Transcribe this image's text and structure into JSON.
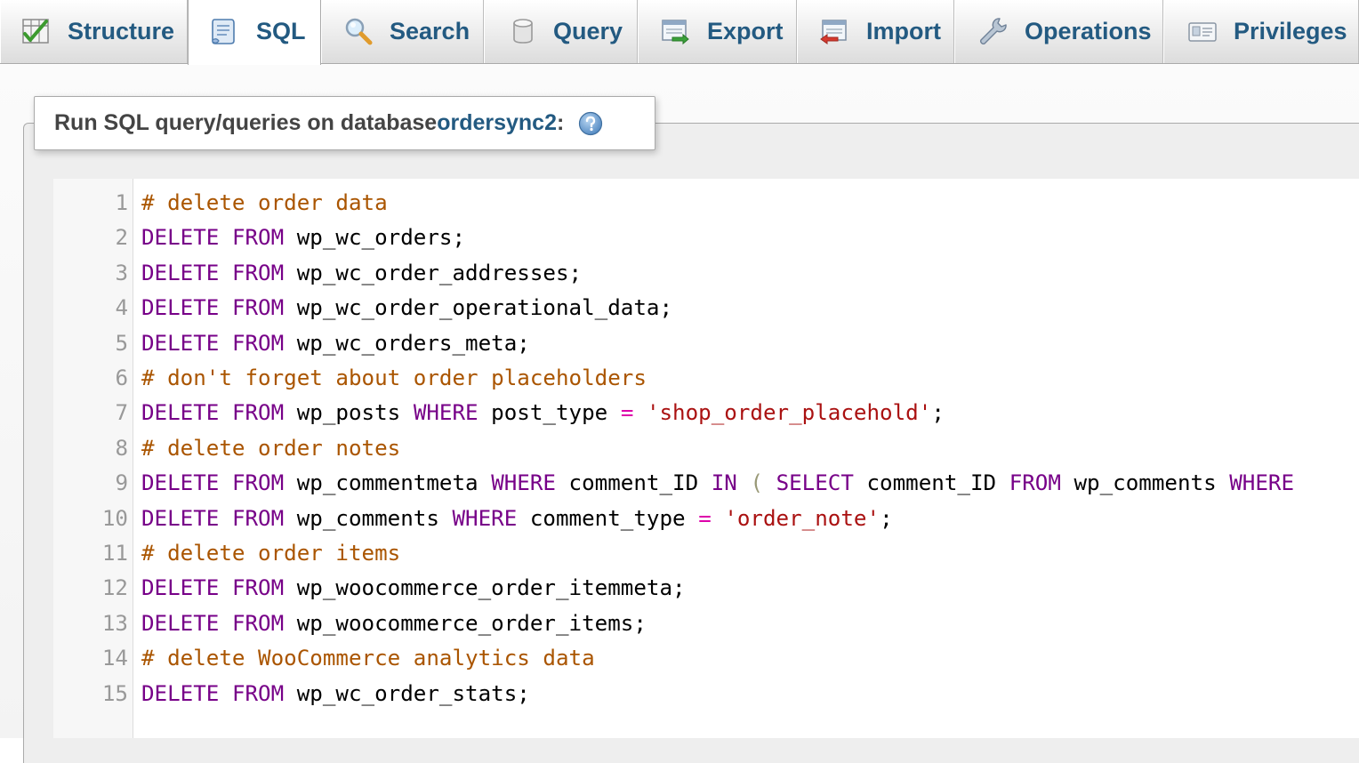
{
  "tabs": [
    {
      "id": "structure",
      "label": "Structure",
      "icon": "structure-icon",
      "active": false
    },
    {
      "id": "sql",
      "label": "SQL",
      "icon": "sql-scroll-icon",
      "active": true
    },
    {
      "id": "search",
      "label": "Search",
      "icon": "magnifier-icon",
      "active": false
    },
    {
      "id": "query",
      "label": "Query",
      "icon": "database-cylinder-icon",
      "active": false
    },
    {
      "id": "export",
      "label": "Export",
      "icon": "export-icon",
      "active": false
    },
    {
      "id": "import",
      "label": "Import",
      "icon": "import-icon",
      "active": false
    },
    {
      "id": "operations",
      "label": "Operations",
      "icon": "wrench-icon",
      "active": false
    },
    {
      "id": "privileges",
      "label": "Privileges",
      "icon": "id-card-icon",
      "active": false
    }
  ],
  "legend": {
    "prefix": "Run SQL query/queries on database ",
    "database": "ordersync2",
    "suffix": ":",
    "help_icon": "help-icon"
  },
  "colors": {
    "link": "#235a81",
    "keyword": "#770088",
    "comment": "#aa5500",
    "string": "#aa1111",
    "operator": "#dd00aa"
  },
  "editor": {
    "lines": [
      {
        "n": "1",
        "tokens": [
          [
            "cm",
            "# delete order data"
          ]
        ]
      },
      {
        "n": "2",
        "tokens": [
          [
            "kw",
            "DELETE"
          ],
          [
            "id",
            " "
          ],
          [
            "kw",
            "FROM"
          ],
          [
            "id",
            " wp_wc_orders;"
          ]
        ]
      },
      {
        "n": "3",
        "tokens": [
          [
            "kw",
            "DELETE"
          ],
          [
            "id",
            " "
          ],
          [
            "kw",
            "FROM"
          ],
          [
            "id",
            " wp_wc_order_addresses;"
          ]
        ]
      },
      {
        "n": "4",
        "tokens": [
          [
            "kw",
            "DELETE"
          ],
          [
            "id",
            " "
          ],
          [
            "kw",
            "FROM"
          ],
          [
            "id",
            " wp_wc_order_operational_data;"
          ]
        ]
      },
      {
        "n": "5",
        "tokens": [
          [
            "kw",
            "DELETE"
          ],
          [
            "id",
            " "
          ],
          [
            "kw",
            "FROM"
          ],
          [
            "id",
            " wp_wc_orders_meta;"
          ]
        ]
      },
      {
        "n": "6",
        "tokens": [
          [
            "cm",
            "# don't forget about order placeholders"
          ]
        ]
      },
      {
        "n": "7",
        "tokens": [
          [
            "kw",
            "DELETE"
          ],
          [
            "id",
            " "
          ],
          [
            "kw",
            "FROM"
          ],
          [
            "id",
            " wp_posts "
          ],
          [
            "kw",
            "WHERE"
          ],
          [
            "id",
            " post_type "
          ],
          [
            "op",
            "="
          ],
          [
            "id",
            " "
          ],
          [
            "st",
            "'shop_order_placehold'"
          ],
          [
            "id",
            ";"
          ]
        ]
      },
      {
        "n": "8",
        "tokens": [
          [
            "cm",
            "# delete order notes"
          ]
        ]
      },
      {
        "n": "9",
        "tokens": [
          [
            "kw",
            "DELETE"
          ],
          [
            "id",
            " "
          ],
          [
            "kw",
            "FROM"
          ],
          [
            "id",
            " wp_commentmeta "
          ],
          [
            "kw",
            "WHERE"
          ],
          [
            "id",
            " comment_ID "
          ],
          [
            "kw",
            "IN"
          ],
          [
            "id",
            " "
          ],
          [
            "pn",
            "("
          ],
          [
            "id",
            " "
          ],
          [
            "kw",
            "SELECT"
          ],
          [
            "id",
            " comment_ID "
          ],
          [
            "kw",
            "FROM"
          ],
          [
            "id",
            " wp_comments "
          ],
          [
            "kw",
            "WHERE"
          ]
        ]
      },
      {
        "n": "10",
        "tokens": [
          [
            "kw",
            "DELETE"
          ],
          [
            "id",
            " "
          ],
          [
            "kw",
            "FROM"
          ],
          [
            "id",
            " wp_comments "
          ],
          [
            "kw",
            "WHERE"
          ],
          [
            "id",
            " comment_type "
          ],
          [
            "op",
            "="
          ],
          [
            "id",
            " "
          ],
          [
            "st",
            "'order_note'"
          ],
          [
            "id",
            ";"
          ]
        ]
      },
      {
        "n": "11",
        "tokens": [
          [
            "cm",
            "# delete order items"
          ]
        ]
      },
      {
        "n": "12",
        "tokens": [
          [
            "kw",
            "DELETE"
          ],
          [
            "id",
            " "
          ],
          [
            "kw",
            "FROM"
          ],
          [
            "id",
            " wp_woocommerce_order_itemmeta;"
          ]
        ]
      },
      {
        "n": "13",
        "tokens": [
          [
            "kw",
            "DELETE"
          ],
          [
            "id",
            " "
          ],
          [
            "kw",
            "FROM"
          ],
          [
            "id",
            " wp_woocommerce_order_items;"
          ]
        ]
      },
      {
        "n": "14",
        "tokens": [
          [
            "cm",
            "# delete WooCommerce analytics data"
          ]
        ]
      },
      {
        "n": "15",
        "tokens": [
          [
            "kw",
            "DELETE"
          ],
          [
            "id",
            " "
          ],
          [
            "kw",
            "FROM"
          ],
          [
            "id",
            " wp_wc_order_stats;"
          ]
        ]
      }
    ]
  }
}
